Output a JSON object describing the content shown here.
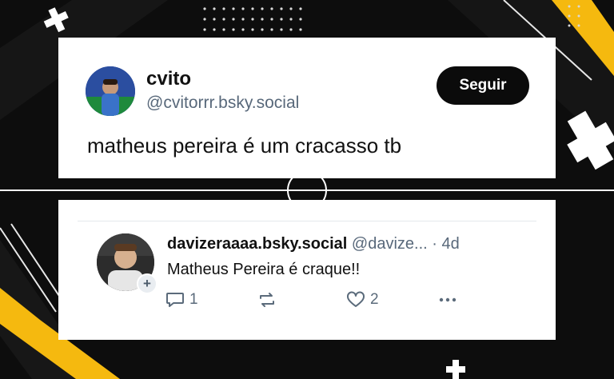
{
  "post": {
    "display_name": "cvito",
    "handle": "@cvitorrr.bsky.social",
    "follow_label": "Seguir",
    "text": "matheus pereira é um cracasso tb"
  },
  "reply": {
    "display_name": "davizeraaaa.bsky.social",
    "handle": "@davize...",
    "separator": "·",
    "time": "4d",
    "text": "Matheus Pereira é craque!!",
    "reply_count": "1",
    "like_count": "2"
  },
  "colors": {
    "background": "#0d0d0d",
    "accent_yellow": "#f5b90f",
    "card": "#ffffff",
    "follow_button": "#0b0b0b",
    "muted_text": "#58687a"
  },
  "icons": [
    "reply-icon",
    "repost-icon",
    "like-icon",
    "more-icon",
    "plus-icon"
  ]
}
